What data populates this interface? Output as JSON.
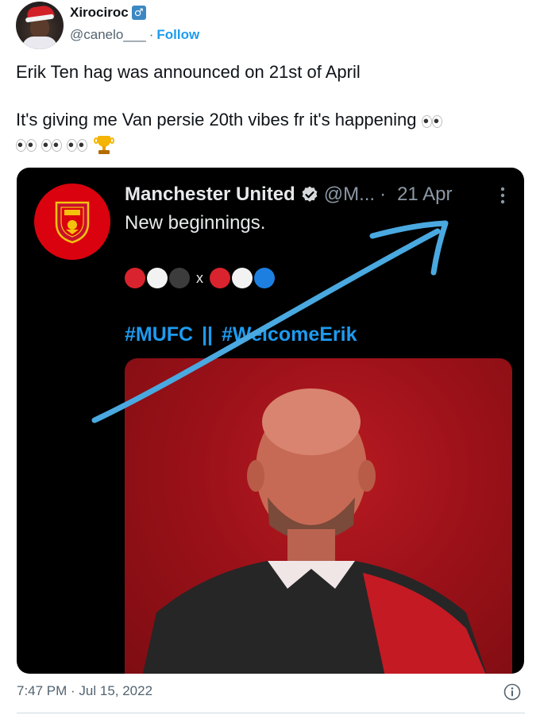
{
  "author": {
    "display_name": "Xirociroc",
    "badge": "♂",
    "handle": "@canelo___",
    "separator": "·",
    "follow_label": "Follow"
  },
  "tweet": {
    "paragraphs": [
      "Erik Ten hag was announced on 21st of April",
      "It's giving me Van persie 20th vibes fr it's happening"
    ],
    "emojis": [
      "eyes",
      "eyes",
      "eyes",
      "eyes",
      "trophy"
    ]
  },
  "embedded_tweet": {
    "name": "Manchester United",
    "handle": "@M...",
    "separator": "·",
    "date": "21 Apr",
    "text": "New beginnings.",
    "dots_left": [
      "#d9232e",
      "#f2f2f2",
      "#3c3c3c"
    ],
    "dots_x": "x",
    "dots_right": [
      "#d9232e",
      "#f2f2f2",
      "#1d7fe0"
    ],
    "hashtag_1": "#MUFC",
    "hashtag_sep": "||",
    "hashtag_2": "#WelcomeErik",
    "annotation_color": "#4aa9e0"
  },
  "footer": {
    "timestamp": "7:47 PM · Jul 15, 2022"
  },
  "colors": {
    "link": "#1d9bf0",
    "muted": "#536471",
    "brand_red": "#da020e"
  },
  "icons": [
    "male-sign-icon",
    "verified-icon",
    "more-options-icon",
    "info-icon",
    "eyes-emoji-icon",
    "trophy-emoji-icon"
  ]
}
